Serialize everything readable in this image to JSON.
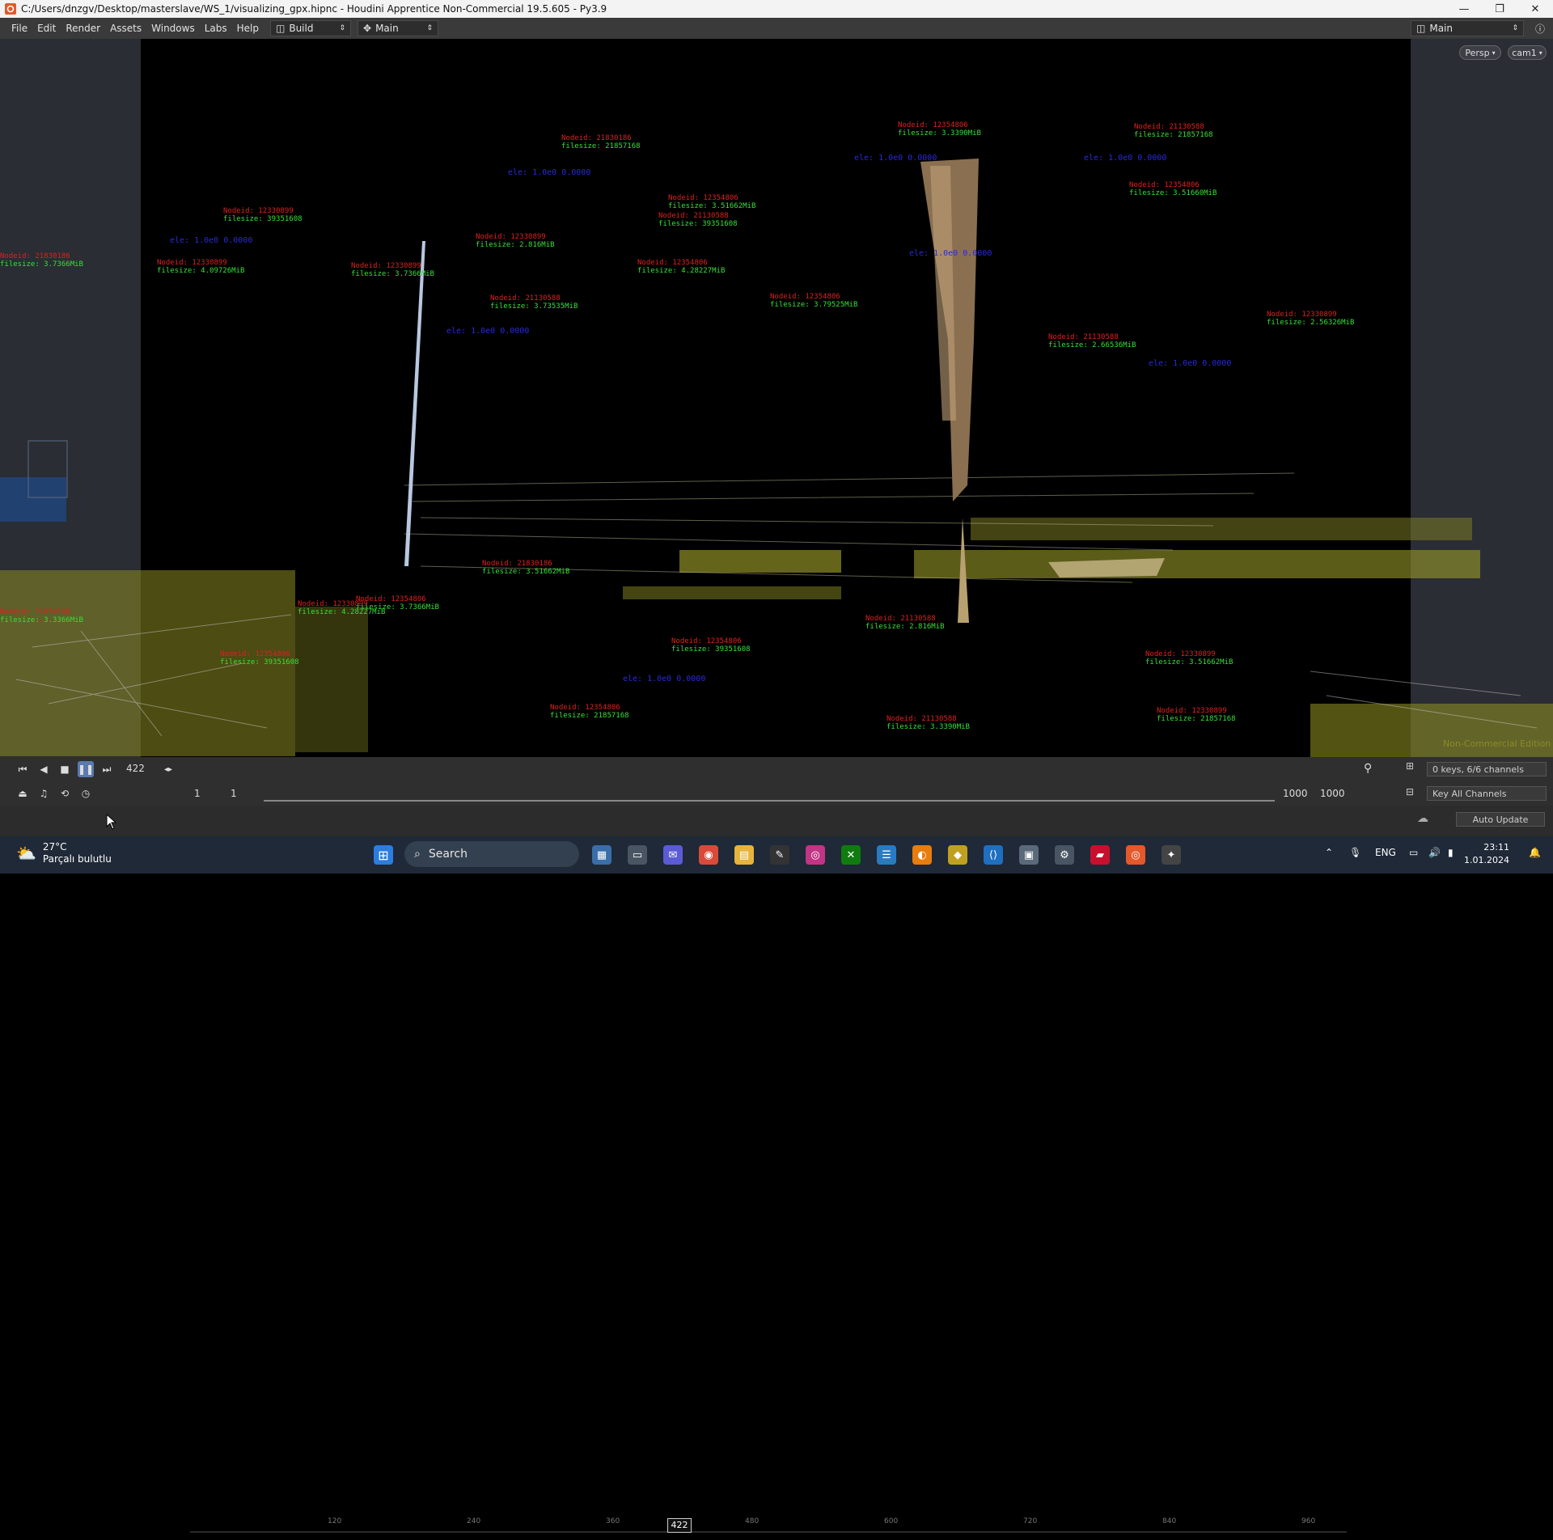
{
  "window": {
    "title": "C:/Users/dnzgv/Desktop/masterslave/WS_1/visualizing_gpx.hipnc - Houdini Apprentice Non-Commercial 19.5.605 - Py3.9",
    "minimize": "—",
    "restore": "❐",
    "close": "✕"
  },
  "menu": {
    "items": [
      "File",
      "Edit",
      "Render",
      "Assets",
      "Windows",
      "Labs",
      "Help"
    ],
    "desktop": "Build",
    "pane": "Main",
    "right_desktop": "Main"
  },
  "viewport": {
    "camera_menu": "Persp",
    "cam_menu": "cam1",
    "watermark": "Non-Commercial Edition",
    "annotations": [
      {
        "red": "Nodeid: 21830186",
        "green": "filesize: 21857168"
      },
      {
        "red": "Nodeid: 12354806",
        "green": "filesize: 3.3390MiB"
      },
      {
        "red": "Nodeid: 21130588",
        "green": "filesize: 21857168"
      },
      {
        "red": "Nodeid: 12330899",
        "green": "filesize: 39351608"
      },
      {
        "red": "Nodeid: 12354806",
        "green": "filesize: 3.51662MiB"
      },
      {
        "red": "Nodeid: 21130588",
        "green": "filesize: 39351608"
      },
      {
        "red": "Nodeid: 12354806",
        "green": "filesize: 3.51660MiB"
      },
      {
        "red": "Nodeid: 12330899",
        "green": "filesize: 2.816MiB"
      },
      {
        "red": "Nodeid: 12354806",
        "green": "filesize: 4.28227MiB"
      },
      {
        "red": "Nodeid: 12330899",
        "green": "filesize: 3.7366MiB"
      },
      {
        "red": "Nodeid: 21130588",
        "green": "filesize: 3.73535MiB"
      },
      {
        "red": "Nodeid: 12354806",
        "green": "filesize: 3.79525MiB"
      },
      {
        "red": "Nodeid: 12330899",
        "green": "filesize: 2.56326MiB"
      },
      {
        "red": "Nodeid: 21130588",
        "green": "filesize: 2.66536MiB"
      },
      {
        "red": "Nodeid: 12330899",
        "green": "filesize: 4.09726MiB"
      },
      {
        "red": "Nodeid: 21830186",
        "green": "filesize: 3.7366MiB"
      },
      {
        "red": "Nodeid: 12354806",
        "green": "filesize: 3.7366MiB"
      },
      {
        "red": "Nodeid: 12330899",
        "green": "filesize: 4.28227MiB"
      },
      {
        "red": "Nodeid: 21830186",
        "green": "filesize: 3.3366MiB"
      },
      {
        "red": "Nodeid: 12354806",
        "green": "filesize: 39351608"
      },
      {
        "red": "Nodeid: 21130588",
        "green": "filesize: 2.816MiB"
      },
      {
        "red": "Nodeid: 12330899",
        "green": "filesize: 3.51662MiB"
      },
      {
        "red": "Nodeid: 12354806",
        "green": "filesize: 21857168"
      },
      {
        "red": "Nodeid: 21130588",
        "green": "filesize: 3.3390MiB"
      },
      {
        "red": "Nodeid: 12330899",
        "green": "filesize: 21857168"
      },
      {
        "red": "Nodeid: 12354806",
        "green": "filesize: 39351608"
      },
      {
        "red": "Nodeid: 21830186",
        "green": "filesize: 3.51662MiB"
      }
    ],
    "blue_labels": [
      "ele: 1.0e0 0.0000",
      "ele: 1.0e0 0.0000",
      "ele: 1.0e0 0.0000",
      "ele: 1.0e0 0.0000",
      "ele: 1.0e0 0.0000",
      "ele: 1.0e0 0.0000",
      "ele: 1.0e0 0.0000",
      "ele: 1.0e0 0.0000"
    ]
  },
  "timeline": {
    "current_frame": "422",
    "marker": "422",
    "ticks": [
      "120",
      "240",
      "360",
      "480",
      "600",
      "720",
      "840",
      "960"
    ],
    "start": "1",
    "start2": "1",
    "end": "1000",
    "end2": "1000",
    "keys": "0 keys, 6/6 channels",
    "key_all": "Key All Channels",
    "auto_update": "Auto Update"
  },
  "taskbar": {
    "weather_temp": "27°C",
    "weather_desc": "Parçalı bulutlu",
    "search": "Search",
    "lang": "ENG",
    "time": "23:11",
    "date": "1.01.2024"
  },
  "colors": {
    "annot_red": "#e02020",
    "annot_green": "#36e036",
    "annot_blue": "#2a2ad8",
    "terrain_yellow": "#b8b840",
    "panel": "#2a2d33"
  }
}
